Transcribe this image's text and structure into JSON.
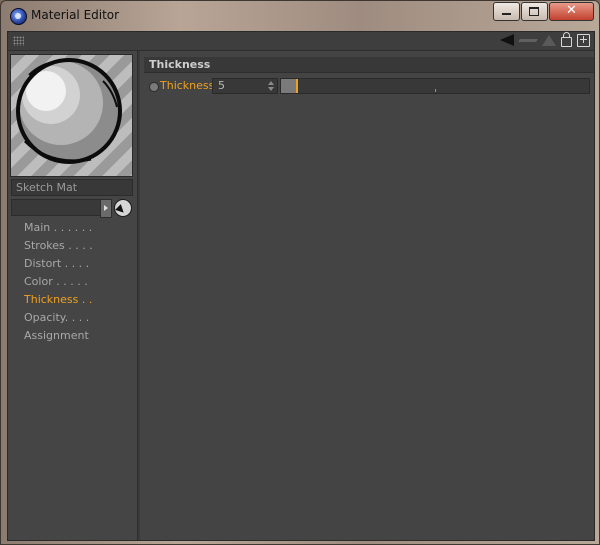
{
  "window": {
    "title": "Material Editor",
    "close_glyph": "✕"
  },
  "material": {
    "name": "Sketch Mat"
  },
  "nav": {
    "items": [
      {
        "label": "Main . . . . . .",
        "active": false
      },
      {
        "label": "Strokes . . . .",
        "active": false
      },
      {
        "label": "Distort . . . .",
        "active": false
      },
      {
        "label": "Color . . . . .",
        "active": false
      },
      {
        "label": "Thickness . .",
        "active": true
      },
      {
        "label": "Opacity. . . .",
        "active": false
      },
      {
        "label": "Assignment",
        "active": false
      }
    ]
  },
  "section": {
    "title": "Thickness"
  },
  "param": {
    "label": "Thickness",
    "value": "5",
    "slider_fraction": 0.05
  },
  "colors": {
    "accent": "#f0a020",
    "panel": "#444444",
    "text": "#a8a8a8"
  }
}
